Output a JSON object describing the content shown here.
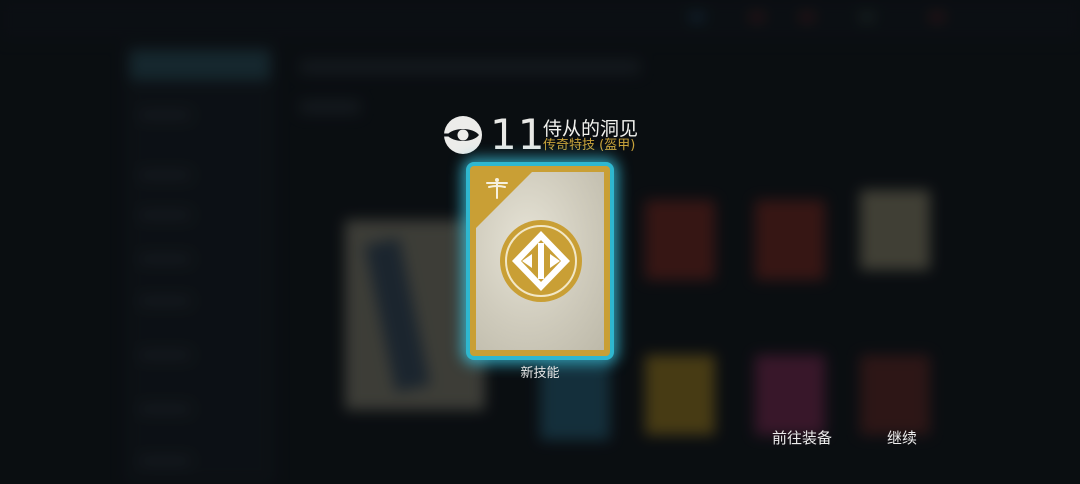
{
  "header": {
    "power_level": "11",
    "title": "侍从的洞见",
    "subtitle": "传奇特技 (盔甲)"
  },
  "card": {
    "label": "新技能",
    "corner_icon": "dragonfly-icon",
    "emblem_icon": "diamond-emblem-icon"
  },
  "actions": {
    "go_to_equipment": "前往装备",
    "continue": "继续"
  },
  "colors": {
    "gold": "#c99f35",
    "glow": "#2fb7cf",
    "subtitle": "#c9a33a"
  }
}
